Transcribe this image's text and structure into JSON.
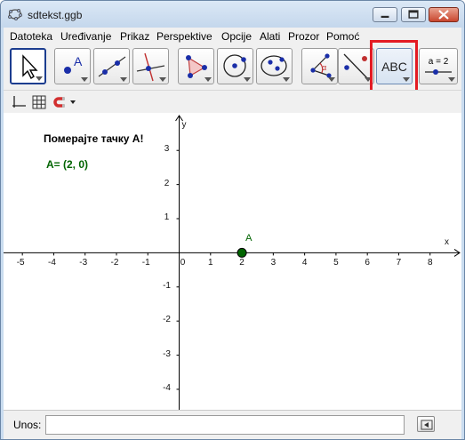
{
  "window": {
    "title": "sdtekst.ggb",
    "controls": [
      "minimize",
      "maximize",
      "close"
    ]
  },
  "menu": [
    "Datoteka",
    "Uređivanje",
    "Prikaz",
    "Perspektive",
    "Opcije",
    "Alati",
    "Prozor",
    "Pomoć"
  ],
  "toolbar": {
    "tools": [
      {
        "name": "move-tool",
        "icon": "arrow-cursor-icon",
        "selected": true
      },
      {
        "name": "point-tool",
        "icon": "point-a-icon"
      },
      {
        "name": "line-tool",
        "icon": "line-through-points-icon"
      },
      {
        "name": "perpendicular-tool",
        "icon": "perpendicular-line-icon"
      },
      {
        "name": "polygon-tool",
        "icon": "polygon-icon"
      },
      {
        "name": "circle-tool",
        "icon": "circle-center-point-icon"
      },
      {
        "name": "ellipse-tool",
        "icon": "ellipse-icon"
      },
      {
        "name": "angle-tool",
        "icon": "angle-icon"
      },
      {
        "name": "reflect-tool",
        "icon": "reflect-point-icon"
      },
      {
        "name": "text-tool",
        "icon": "abc-text-icon",
        "label": "ABC",
        "active": true
      },
      {
        "name": "slider-tool",
        "icon": "slider-icon",
        "label": "a = 2"
      }
    ]
  },
  "stylebar": [
    "axes-icon",
    "grid-icon",
    "magnet-icon",
    "dropdown-arrow-icon"
  ],
  "graphics": {
    "caption": "Померајте тачку А!",
    "coordinate_text": "A= (2, 0)",
    "x_axis_label": "x",
    "y_axis_label": "y",
    "x_ticks": [
      "-5",
      "-4",
      "-3",
      "-2",
      "-1",
      "0",
      "1",
      "2",
      "3",
      "4",
      "5",
      "6",
      "7",
      "8"
    ],
    "y_ticks": [
      "3",
      "2",
      "1",
      "-1",
      "-2",
      "-3",
      "-4"
    ],
    "point": {
      "label": "A",
      "x": 2,
      "y": 0,
      "color": "#006400"
    },
    "x_range": [
      -5.6,
      9.0
    ],
    "y_range": [
      -4.6,
      4.1
    ]
  },
  "input_bar": {
    "label": "Unos:",
    "value": "",
    "button_icon": "input-help-arrow-icon"
  },
  "highlight": {
    "target": "text-tool",
    "color": "#e31b23"
  }
}
